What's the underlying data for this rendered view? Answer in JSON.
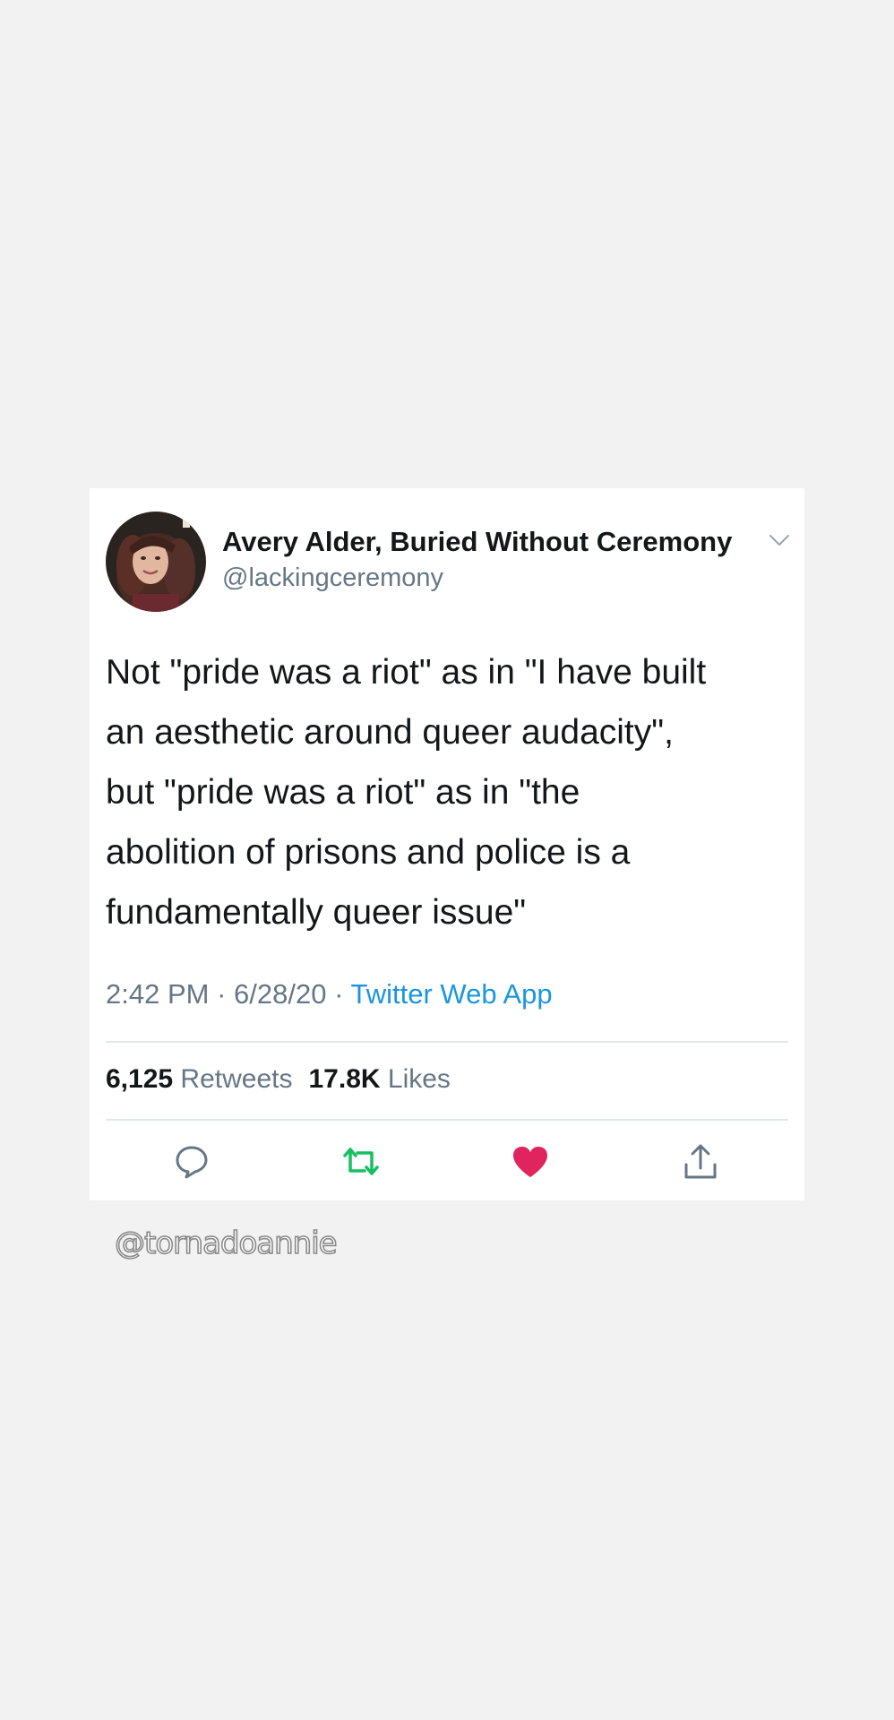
{
  "tweet": {
    "author": {
      "display_name": "Avery Alder, Buried Without Ceremony",
      "handle": "@lackingceremony",
      "avatar": "profile-photo"
    },
    "text_lines": [
      "Not \"pride was a riot\" as in \"I have built",
      "an aesthetic around queer audacity\",",
      "but \"pride was a riot\" as in \"the",
      "abolition of prisons and police is a",
      "fundamentally queer issue\""
    ],
    "time": "2:42 PM",
    "date": "6/28/20",
    "separator": "·",
    "source": "Twitter Web App",
    "stats": {
      "retweets_count": "6,125",
      "retweets_label": "Retweets",
      "likes_count": "17.8K",
      "likes_label": "Likes"
    },
    "actions": {
      "reply_icon": "reply-icon",
      "retweet_icon": "retweet-icon",
      "like_icon": "heart-icon",
      "share_icon": "share-icon"
    }
  },
  "watermark": "@tornadoannie",
  "colors": {
    "background": "#f2f2f2",
    "card": "#ffffff",
    "text": "#14171a",
    "secondary": "#657786",
    "link": "#1b95e0",
    "retweet_green": "#17bf63",
    "like_red": "#e0245e"
  }
}
